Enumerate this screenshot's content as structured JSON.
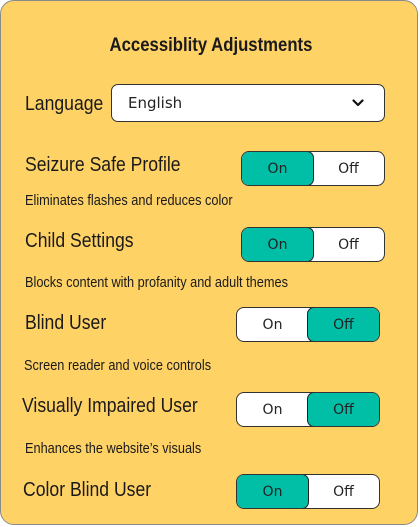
{
  "title": "Accessiblity Adjustments",
  "language": {
    "label": "Language",
    "selected": "English",
    "chevron_icon": "chevron-down-icon"
  },
  "settings": [
    {
      "label": "Seizure Safe Profile",
      "description": "Eliminates flashes and reduces color",
      "on_label": "On",
      "off_label": "Off",
      "state": "on"
    },
    {
      "label": "Child Settings",
      "description": "Blocks content with profanity and adult themes",
      "on_label": "On",
      "off_label": "Off",
      "state": "on"
    },
    {
      "label": "Blind User",
      "description": "Screen reader and voice controls",
      "on_label": "On",
      "off_label": "Off",
      "state": "off"
    },
    {
      "label": "Visually Impaired User",
      "description": "Enhances the website’s visuals",
      "on_label": "On",
      "off_label": "Off",
      "state": "off"
    },
    {
      "label": "Color Blind User",
      "description": "",
      "on_label": "On",
      "off_label": "Off",
      "state": "on"
    }
  ],
  "colors": {
    "panel_background": "#ffd266",
    "toggle_active": "#00bfa6"
  }
}
